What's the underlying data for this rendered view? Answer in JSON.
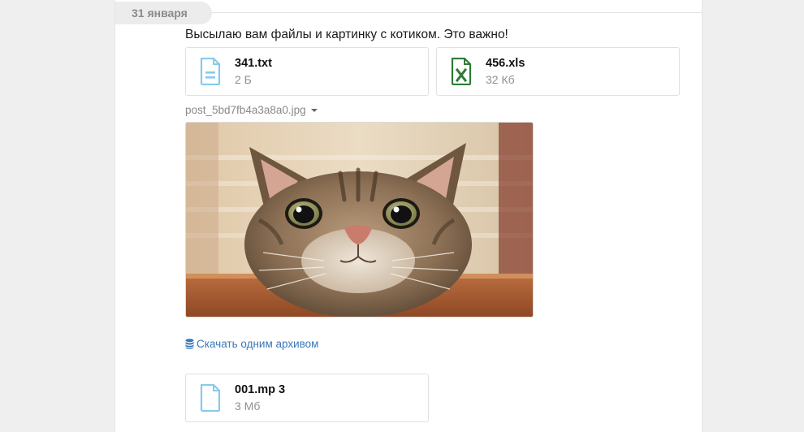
{
  "date_label": "31 января",
  "message": {
    "text": "Высылаю вам файлы и картинку с котиком. Это важно!",
    "files_top": [
      {
        "name": "341.txt",
        "size": "2 Б",
        "icon": "text-file-icon",
        "color": "#88c9ec"
      },
      {
        "name": "456.xls",
        "size": "32 Кб",
        "icon": "excel-file-icon",
        "color": "#2f7a36"
      }
    ],
    "image": {
      "caption": "post_5bd7fb4a3a8a0.jpg",
      "subject": "cat-photo"
    },
    "archive_link": "Скачать одним архивом",
    "files_bottom": [
      {
        "name": "001.mp 3",
        "size": "3 Мб",
        "icon": "audio-file-icon",
        "color": "#88c9ec"
      }
    ]
  },
  "colors": {
    "link": "#3a78b7",
    "page_bg": "#efefef",
    "panel_bg": "#ffffff"
  }
}
